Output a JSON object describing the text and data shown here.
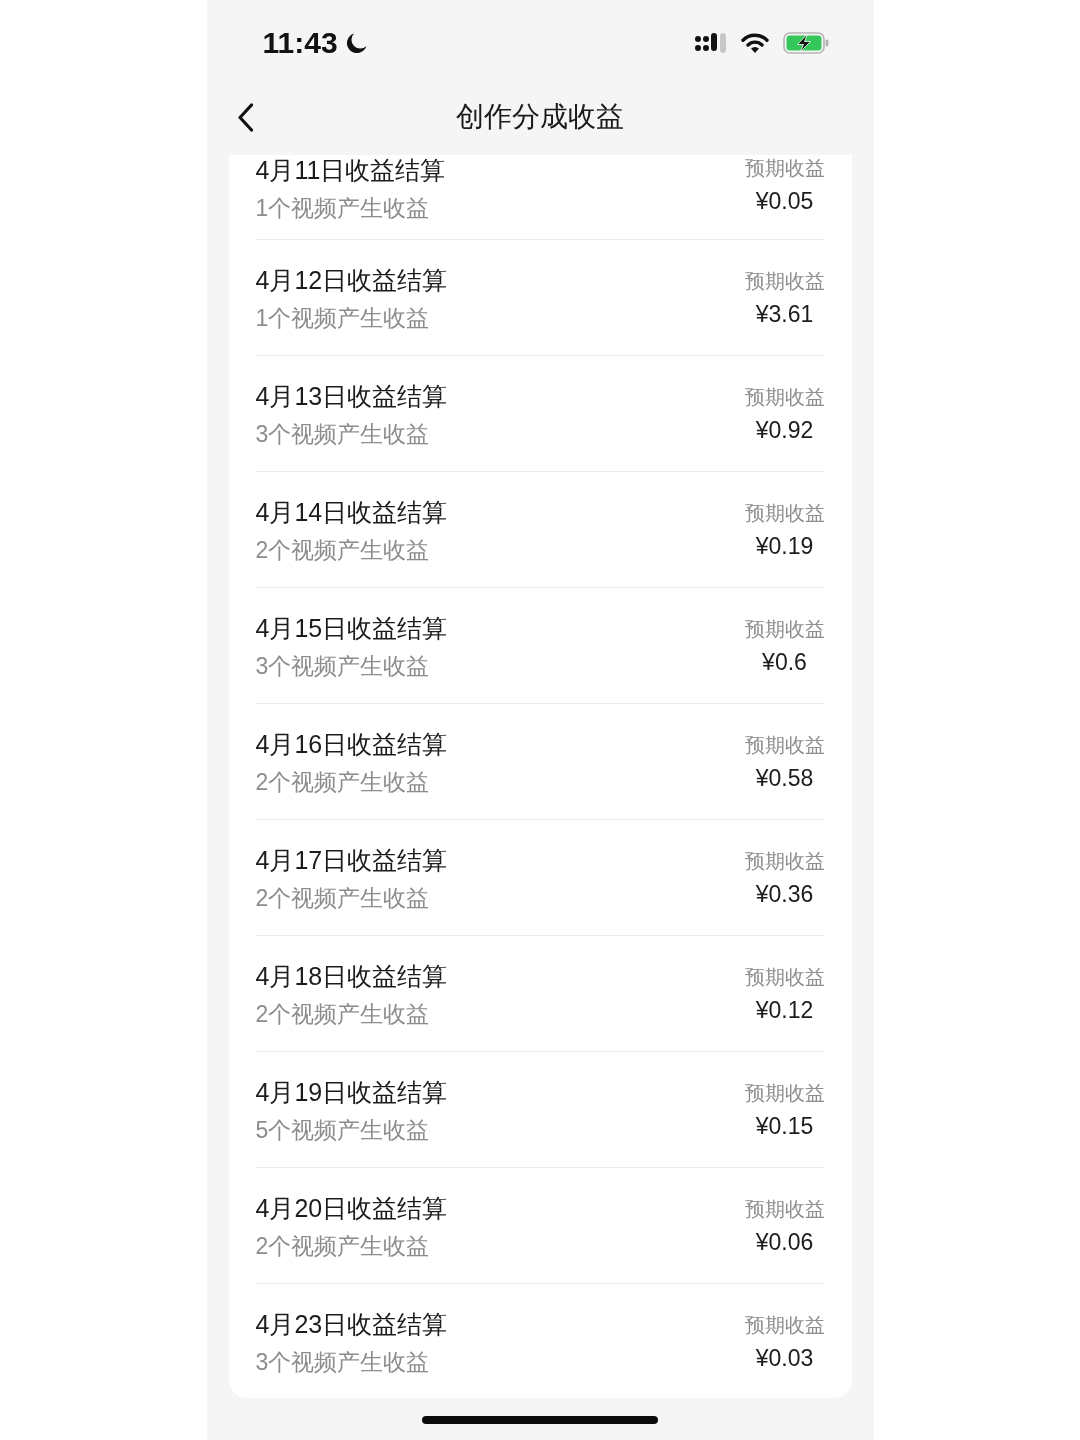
{
  "status_bar": {
    "time": "11:43"
  },
  "nav_bar": {
    "title": "创作分成收益"
  },
  "settlements": [
    {
      "title": "4月11日收益结算",
      "subtitle": "1个视频产生收益",
      "label": "预期收益",
      "amount": "¥0.05"
    },
    {
      "title": "4月12日收益结算",
      "subtitle": "1个视频产生收益",
      "label": "预期收益",
      "amount": "¥3.61"
    },
    {
      "title": "4月13日收益结算",
      "subtitle": "3个视频产生收益",
      "label": "预期收益",
      "amount": "¥0.92"
    },
    {
      "title": "4月14日收益结算",
      "subtitle": "2个视频产生收益",
      "label": "预期收益",
      "amount": "¥0.19"
    },
    {
      "title": "4月15日收益结算",
      "subtitle": "3个视频产生收益",
      "label": "预期收益",
      "amount": "¥0.6"
    },
    {
      "title": "4月16日收益结算",
      "subtitle": "2个视频产生收益",
      "label": "预期收益",
      "amount": "¥0.58"
    },
    {
      "title": "4月17日收益结算",
      "subtitle": "2个视频产生收益",
      "label": "预期收益",
      "amount": "¥0.36"
    },
    {
      "title": "4月18日收益结算",
      "subtitle": "2个视频产生收益",
      "label": "预期收益",
      "amount": "¥0.12"
    },
    {
      "title": "4月19日收益结算",
      "subtitle": "5个视频产生收益",
      "label": "预期收益",
      "amount": "¥0.15"
    },
    {
      "title": "4月20日收益结算",
      "subtitle": "2个视频产生收益",
      "label": "预期收益",
      "amount": "¥0.06"
    },
    {
      "title": "4月23日收益结算",
      "subtitle": "3个视频产生收益",
      "label": "预期收益",
      "amount": "¥0.03"
    }
  ]
}
